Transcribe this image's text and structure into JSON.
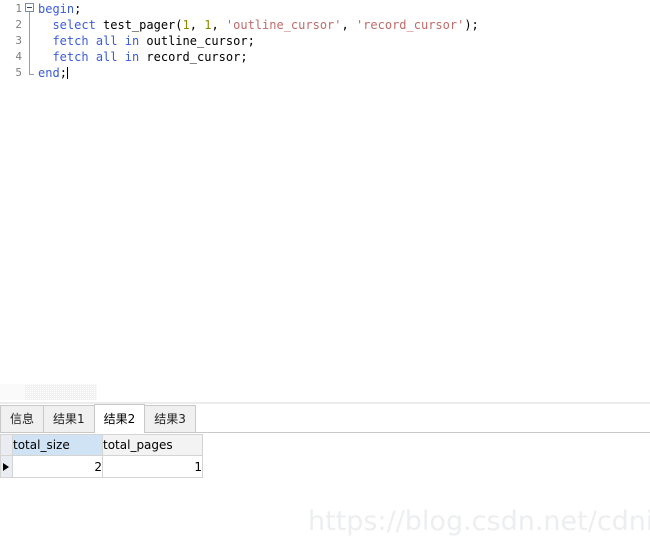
{
  "editor": {
    "lines": [
      {
        "number": "1",
        "fold": "start",
        "tokens": [
          {
            "text": "begin",
            "type": "kw"
          },
          {
            "text": ";",
            "type": "punc"
          }
        ]
      },
      {
        "number": "2",
        "fold": "mid",
        "tokens": [
          {
            "text": "  ",
            "type": "punc"
          },
          {
            "text": "select",
            "type": "kw"
          },
          {
            "text": " test_pager",
            "type": "ident"
          },
          {
            "text": "(",
            "type": "punc"
          },
          {
            "text": "1",
            "type": "num"
          },
          {
            "text": ", ",
            "type": "punc"
          },
          {
            "text": "1",
            "type": "num"
          },
          {
            "text": ", ",
            "type": "punc"
          },
          {
            "text": "'outline_cursor'",
            "type": "str"
          },
          {
            "text": ", ",
            "type": "punc"
          },
          {
            "text": "'record_cursor'",
            "type": "str"
          },
          {
            "text": ");",
            "type": "punc"
          }
        ]
      },
      {
        "number": "3",
        "fold": "mid",
        "tokens": [
          {
            "text": "  ",
            "type": "punc"
          },
          {
            "text": "fetch",
            "type": "kw"
          },
          {
            "text": " ",
            "type": "punc"
          },
          {
            "text": "all",
            "type": "kw"
          },
          {
            "text": " ",
            "type": "punc"
          },
          {
            "text": "in",
            "type": "kw"
          },
          {
            "text": " outline_cursor",
            "type": "ident"
          },
          {
            "text": ";",
            "type": "punc"
          }
        ]
      },
      {
        "number": "4",
        "fold": "mid",
        "tokens": [
          {
            "text": "  ",
            "type": "punc"
          },
          {
            "text": "fetch",
            "type": "kw"
          },
          {
            "text": " ",
            "type": "punc"
          },
          {
            "text": "all",
            "type": "kw"
          },
          {
            "text": " ",
            "type": "punc"
          },
          {
            "text": "in",
            "type": "kw"
          },
          {
            "text": " record_cursor",
            "type": "ident"
          },
          {
            "text": ";",
            "type": "punc"
          }
        ]
      },
      {
        "number": "5",
        "fold": "end",
        "caret": true,
        "tokens": [
          {
            "text": "end",
            "type": "kw"
          },
          {
            "text": ";",
            "type": "punc"
          }
        ]
      }
    ]
  },
  "results": {
    "tabs": [
      {
        "label": "信息",
        "active": false
      },
      {
        "label": "结果1",
        "active": false
      },
      {
        "label": "结果2",
        "active": true
      },
      {
        "label": "结果3",
        "active": false
      }
    ],
    "grid": {
      "columns": [
        {
          "label": "total_size",
          "selected": true,
          "widthClass": "w-total-size"
        },
        {
          "label": "total_pages",
          "selected": false,
          "widthClass": "w-total-pages"
        }
      ],
      "rows": [
        {
          "indicator": true,
          "cells": [
            "2",
            "1"
          ]
        }
      ]
    }
  },
  "watermark": {
    "text": "https://blog.csdn.net/cdnight"
  },
  "colors": {
    "keyword": "#3b5bdb",
    "string": "#c26a6a",
    "number": "#8a8a00",
    "identifier": "#000000",
    "gutter": "#808080",
    "selected_column_header": "#cfe3f5",
    "watermark": "#eceef0"
  }
}
